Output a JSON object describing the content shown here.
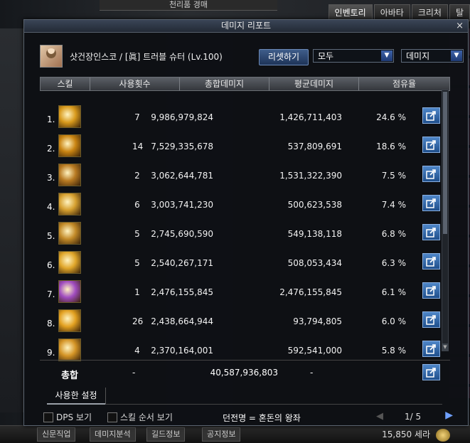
{
  "background": {
    "top_title": "천리품 경매",
    "tabs": [
      "인벤토리",
      "아바타",
      "크리처",
      "탈"
    ],
    "bottom_tabs": [
      "신문직업",
      "데미지분석",
      "길드정보",
      "공지정보"
    ],
    "money": "15,850 세라"
  },
  "window": {
    "title": "데미지 리포트",
    "close_symbol": "×"
  },
  "character": {
    "name": "샷건장인스코 / [眞] 트러블 슈터 (Lv.100)"
  },
  "controls": {
    "reset_label": "리셋하기",
    "filter_value": "모두",
    "sort_value": "데미지"
  },
  "table": {
    "headers": [
      "스킬",
      "사용횟수",
      "총합데미지",
      "평균데미지",
      "점유율"
    ],
    "rows": [
      {
        "rank": "1.",
        "uses": "7",
        "total": "9,986,979,824",
        "avg": "1,426,711,403",
        "pct": "24.6 %",
        "icon_color": "#d89a1c"
      },
      {
        "rank": "2.",
        "uses": "14",
        "total": "7,529,335,678",
        "avg": "537,809,691",
        "pct": "18.6 %",
        "icon_color": "#c98412"
      },
      {
        "rank": "3.",
        "uses": "2",
        "total": "3,062,644,781",
        "avg": "1,531,322,390",
        "pct": "7.5 %",
        "icon_color": "#b87a22"
      },
      {
        "rank": "4.",
        "uses": "6",
        "total": "3,003,741,230",
        "avg": "500,623,538",
        "pct": "7.4 %",
        "icon_color": "#d6a030"
      },
      {
        "rank": "5.",
        "uses": "5",
        "total": "2,745,690,590",
        "avg": "549,138,118",
        "pct": "6.8 %",
        "icon_color": "#c28a28"
      },
      {
        "rank": "6.",
        "uses": "5",
        "total": "2,540,267,171",
        "avg": "508,053,434",
        "pct": "6.3 %",
        "icon_color": "#e0a62a"
      },
      {
        "rank": "7.",
        "uses": "1",
        "total": "2,476,155,845",
        "avg": "2,476,155,845",
        "pct": "6.1 %",
        "icon_color": "#a04cc0"
      },
      {
        "rank": "8.",
        "uses": "26",
        "total": "2,438,664,944",
        "avg": "93,794,805",
        "pct": "6.0 %",
        "icon_color": "#e2a020"
      },
      {
        "rank": "9.",
        "uses": "4",
        "total": "2,370,164,001",
        "avg": "592,541,000",
        "pct": "5.8 %",
        "icon_color": "#d49426"
      }
    ]
  },
  "summary": {
    "label": "총합",
    "uses": "-",
    "total": "40,587,936,803",
    "avg": "-"
  },
  "settings_tab": "사용한 설정",
  "bottom": {
    "dps_label": "DPS 보기",
    "skill_order_label": "스킬 순서 보기",
    "dungeon_text": "던전명 = 혼돈의 왕좌",
    "page": "1/ 5"
  }
}
